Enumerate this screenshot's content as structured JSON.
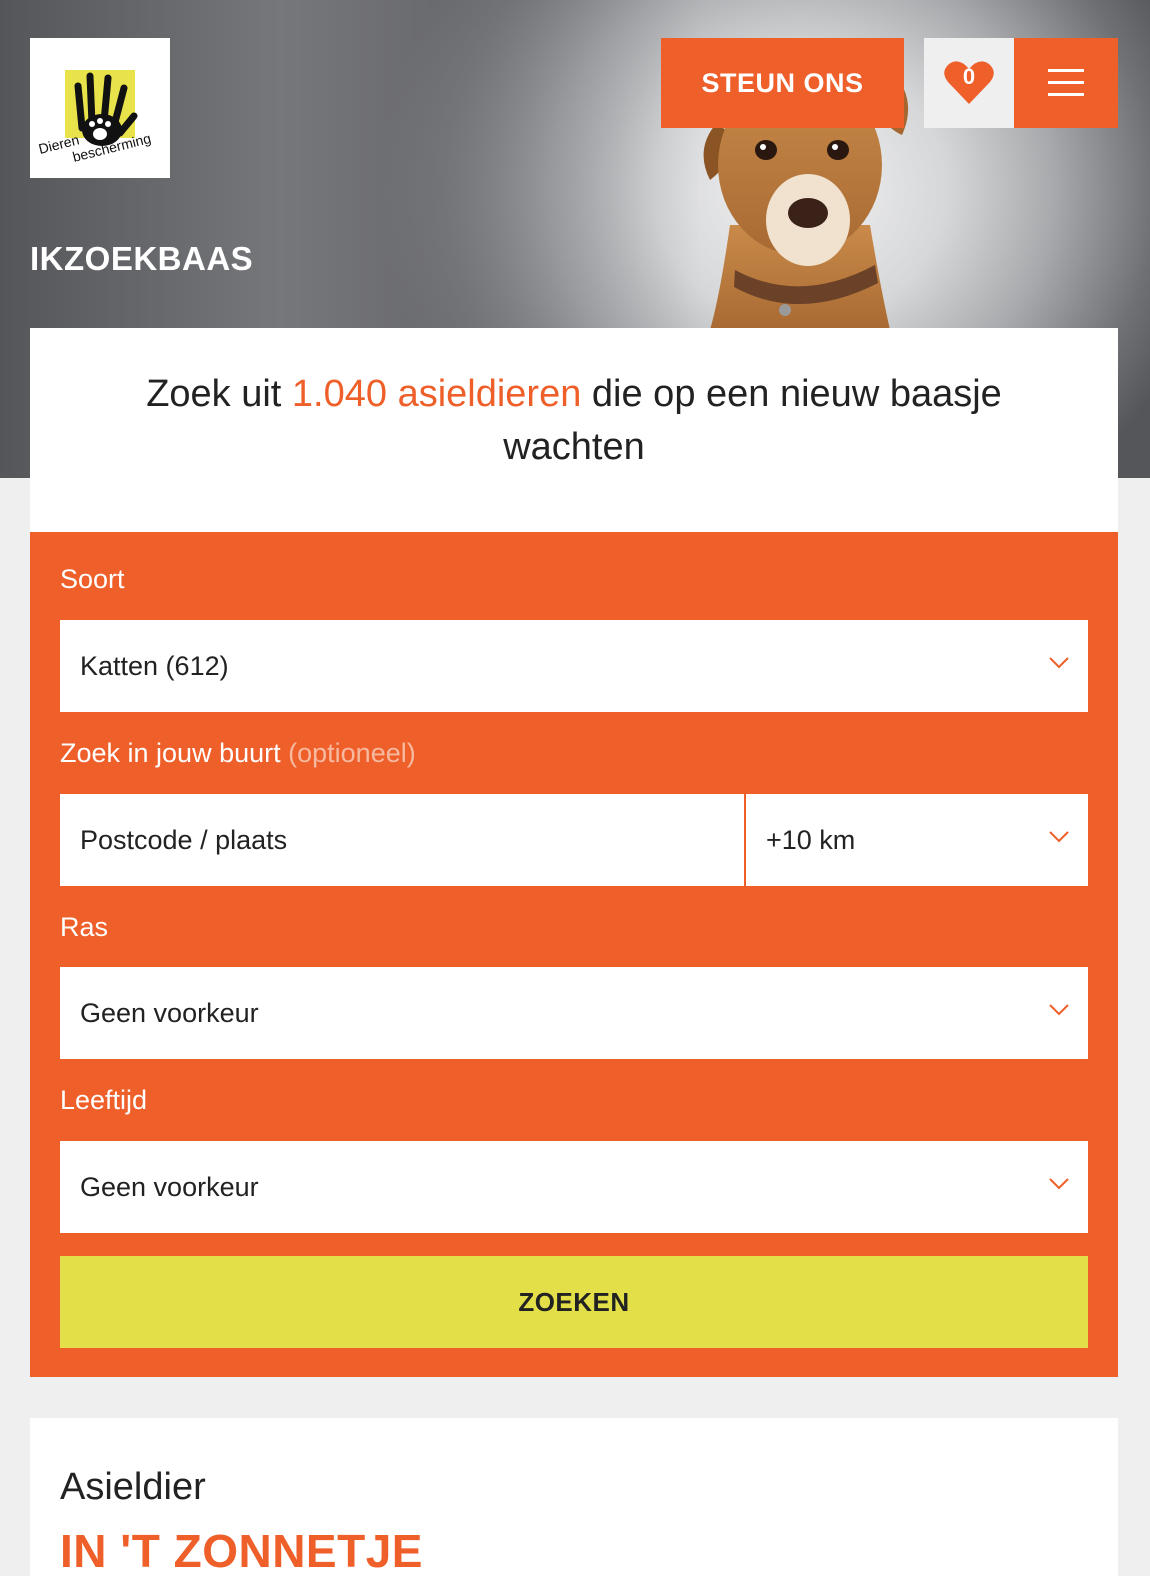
{
  "header": {
    "logo_text_1": "Dieren",
    "logo_text_2": "bescherming",
    "steun_label": "STEUN ONS",
    "favorites_count": "0",
    "page_heading": "IKZOEKBAAS"
  },
  "intro": {
    "prefix": "Zoek uit ",
    "highlight": "1.040 asieldieren",
    "suffix": " die op een nieuw baasje wachten"
  },
  "search": {
    "soort_label": "Soort",
    "soort_value": "Katten (612)",
    "buurt_label": "Zoek in jouw buurt",
    "buurt_optional": "(optioneel)",
    "postcode_placeholder": "Postcode / plaats",
    "distance_value": "+10 km",
    "ras_label": "Ras",
    "ras_value": "Geen voorkeur",
    "leeftijd_label": "Leeftijd",
    "leeftijd_value": "Geen voorkeur",
    "submit_label": "ZOEKEN"
  },
  "featured": {
    "subtitle": "Asieldier",
    "title": "IN 'T ZONNETJE"
  },
  "colors": {
    "accent": "#ee5f2a",
    "button_yellow": "#e2df48",
    "logo_yellow": "#e8e34a"
  }
}
